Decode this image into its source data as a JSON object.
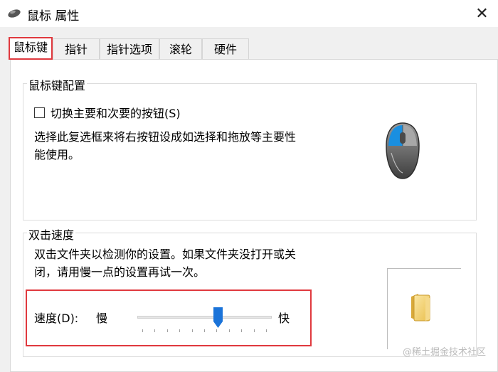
{
  "window": {
    "title": "鼠标 属性",
    "close_symbol": "✕",
    "icon": "mouse-icon"
  },
  "tabs": [
    {
      "label": "鼠标键",
      "active": true
    },
    {
      "label": "指针",
      "active": false
    },
    {
      "label": "指针选项",
      "active": false
    },
    {
      "label": "滚轮",
      "active": false
    },
    {
      "label": "硬件",
      "active": false
    }
  ],
  "button_config": {
    "group_title": "鼠标键配置",
    "checkbox_label": "切换主要和次要的按钮(S)",
    "checked": false,
    "description_line1": "选择此复选框来将右按钮设成如选择和拖放等主要性",
    "description_line2": "能使用。",
    "illustration_icon": "mouse-illustration-icon"
  },
  "double_click": {
    "group_title": "双击速度",
    "description_line1": "双击文件夹以检测你的设置。如果文件夹没打开或关",
    "description_line2": "闭，请用慢一点的设置再试一次。",
    "speed_label": "速度(D):",
    "slow_label": "慢",
    "fast_label": "快",
    "slider_fraction": 0.6,
    "tick_count": 11,
    "test_icon": "folder-icon"
  },
  "watermark": "@稀土掘金技术社区",
  "colors": {
    "highlight": "#e0393e",
    "thumb": "#1a73d9",
    "folder": "#f3d27a"
  }
}
